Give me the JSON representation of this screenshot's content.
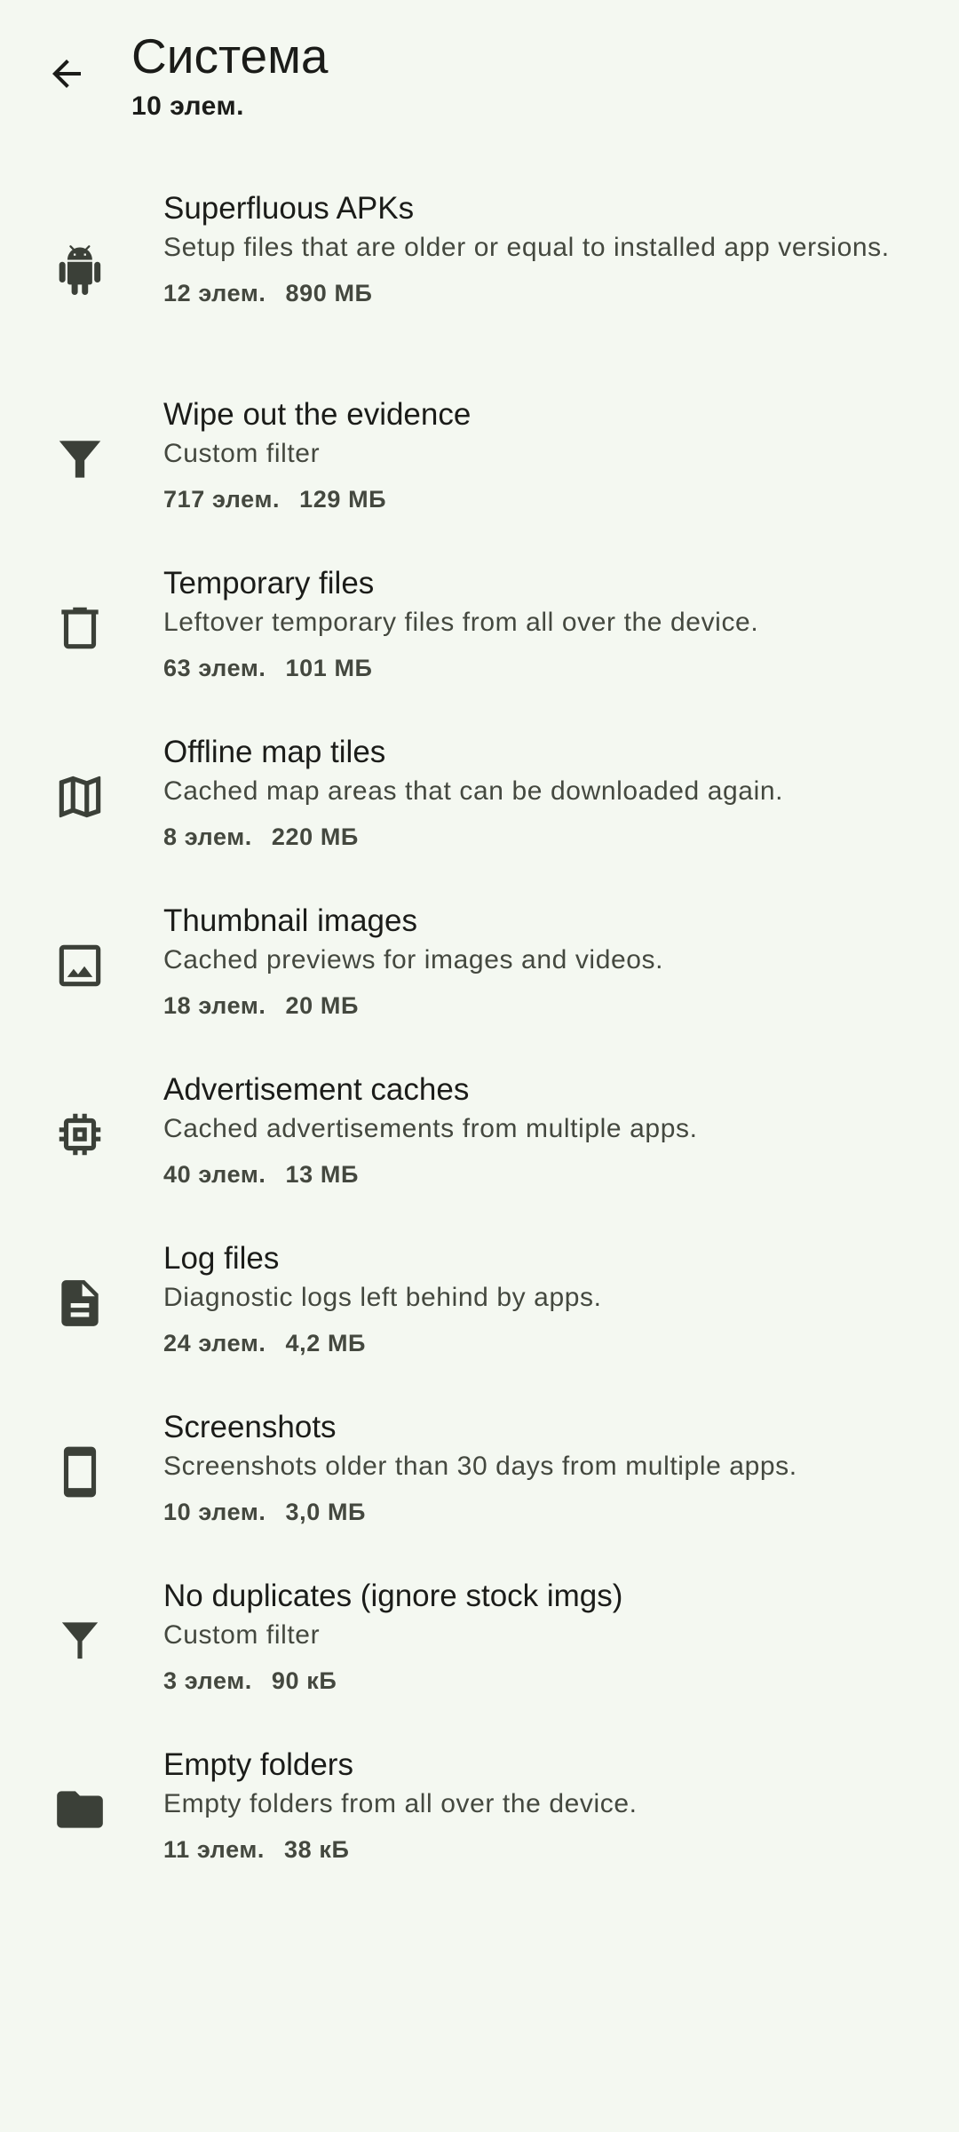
{
  "header": {
    "title": "Система",
    "subtitle": "10 элем."
  },
  "items": [
    {
      "icon": "android-icon",
      "title": "Superfluous APKs",
      "description": "Setup files that are older or equal to installed app versions.",
      "count": "12 элем.",
      "size": "890 МБ"
    },
    {
      "icon": "filter-icon",
      "title": "Wipe out the evidence",
      "description": "Custom filter",
      "count": "717 элем.",
      "size": "129 МБ"
    },
    {
      "icon": "trash-icon",
      "title": "Temporary files",
      "description": "Leftover temporary files from all over the device.",
      "count": "63 элем.",
      "size": "101 МБ"
    },
    {
      "icon": "map-icon",
      "title": "Offline map tiles",
      "description": "Cached map areas that can be downloaded again.",
      "count": "8 элем.",
      "size": "220 МБ"
    },
    {
      "icon": "image-icon",
      "title": "Thumbnail images",
      "description": "Cached previews for images and videos.",
      "count": "18 элем.",
      "size": "20 МБ"
    },
    {
      "icon": "chip-icon",
      "title": "Advertisement caches",
      "description": "Cached advertisements from multiple apps.",
      "count": "40 элем.",
      "size": "13 МБ"
    },
    {
      "icon": "document-icon",
      "title": "Log files",
      "description": "Diagnostic logs left behind by apps.",
      "count": "24 элем.",
      "size": "4,2 МБ"
    },
    {
      "icon": "phone-icon",
      "title": "Screenshots",
      "description": "Screenshots older than 30 days from multiple apps.",
      "count": "10 элем.",
      "size": "3,0 МБ"
    },
    {
      "icon": "filter-icon",
      "title": "No duplicates (ignore stock imgs)",
      "description": "Custom filter",
      "count": "3 элем.",
      "size": "90 кБ"
    },
    {
      "icon": "folder-icon",
      "title": "Empty folders",
      "description": "Empty folders from all over the device.",
      "count": "11 элем.",
      "size": "38 кБ"
    }
  ]
}
